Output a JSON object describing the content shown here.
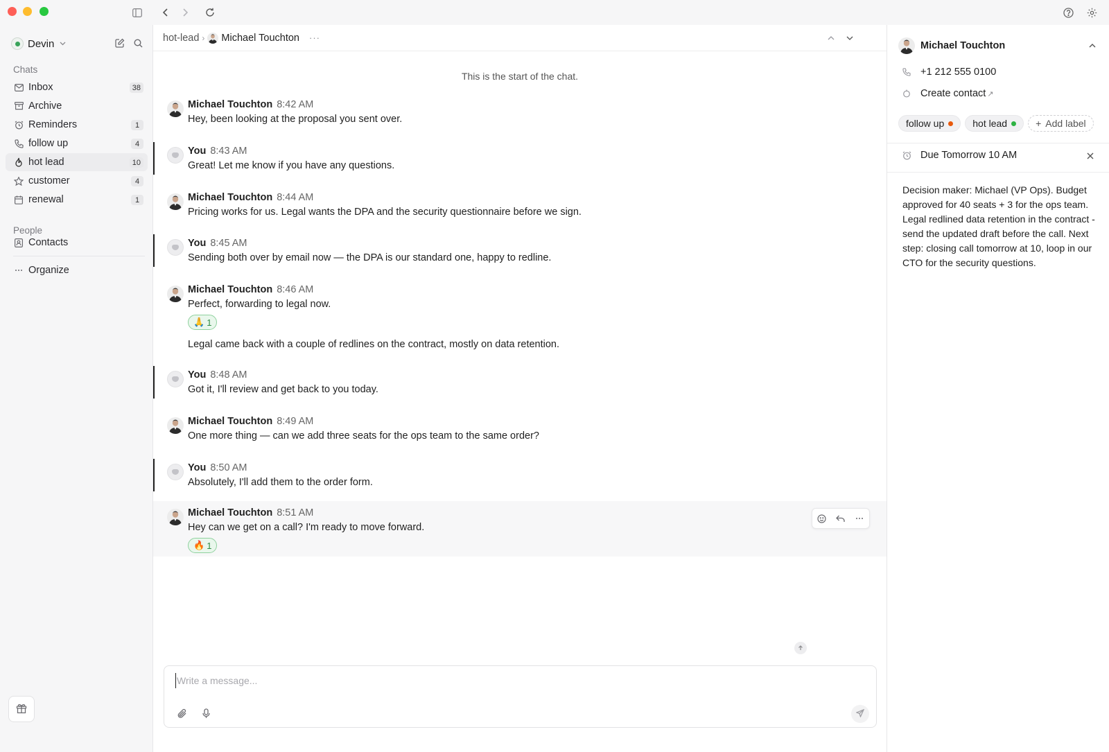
{
  "sidebar": {
    "account_name": "Devin",
    "chats_label": "Chats",
    "items": [
      {
        "label": "Inbox",
        "count": "38",
        "icon": "inbox-icon"
      },
      {
        "label": "Archive",
        "count": "",
        "icon": "archive-icon"
      },
      {
        "label": "Reminders",
        "count": "1",
        "icon": "alarm-clock-icon"
      },
      {
        "label": "follow up",
        "count": "4",
        "icon": "phone-icon"
      },
      {
        "label": "hot lead",
        "count": "10",
        "icon": "flame-icon"
      },
      {
        "label": "customer",
        "count": "4",
        "icon": "star-icon"
      },
      {
        "label": "renewal",
        "count": "1",
        "icon": "calendar-icon"
      }
    ],
    "people_label": "People",
    "contacts_label": "Contacts",
    "organize_label": "Organize"
  },
  "chat": {
    "breadcrumb_parent": "hot-lead",
    "breadcrumb_contact": "Michael Touchton",
    "start_note": "This is the start of the chat.",
    "messages": [
      {
        "sender": "Michael Touchton",
        "time": "8:42 AM",
        "text": "Hey, been looking at the proposal you sent over."
      },
      {
        "sender": "You",
        "time": "8:43 AM",
        "text": "Great! Let me know if you have any questions."
      },
      {
        "sender": "Michael Touchton",
        "time": "8:44 AM",
        "text": "Pricing works for us. Legal wants the DPA and the security questionnaire before we sign."
      },
      {
        "sender": "You",
        "time": "8:45 AM",
        "text": "Sending both over by email now — the DPA is our standard one, happy to redline."
      },
      {
        "sender": "Michael Touchton",
        "time": "8:46 AM",
        "text": "Perfect, forwarding to legal now.",
        "reaction": {
          "emoji": "🙏",
          "count": "1"
        },
        "followup": "Legal came back with a couple of redlines on the contract, mostly on data retention."
      },
      {
        "sender": "You",
        "time": "8:48 AM",
        "text": "Got it, I'll review and get back to you today."
      },
      {
        "sender": "Michael Touchton",
        "time": "8:49 AM",
        "text": "One more thing — can we add three seats for the ops team to the same order?"
      },
      {
        "sender": "You",
        "time": "8:50 AM",
        "text": "Absolutely, I'll add them to the order form."
      },
      {
        "sender": "Michael Touchton",
        "time": "8:51 AM",
        "text": "Hey can we get on a call? I'm ready to move forward.",
        "reaction": {
          "emoji": "🔥",
          "count": "1"
        }
      }
    ],
    "composer_placeholder": "Write a message..."
  },
  "contact_panel": {
    "name": "Michael Touchton",
    "phone": "+1 212 555 0100",
    "create_contact": "Create contact",
    "labels": [
      {
        "label": "follow up",
        "color": "#e8590c"
      },
      {
        "label": "hot lead",
        "color": "#2fb344"
      }
    ],
    "add_label": "Add label",
    "reminder": "Due Tomorrow 10 AM",
    "notes": "Decision maker: Michael (VP Ops). Budget approved for 40 seats + 3 for the ops team. Legal redlined data retention in the contract - send the updated draft before the call. Next step: closing call tomorrow at 10, loop in our CTO for the security questions."
  }
}
